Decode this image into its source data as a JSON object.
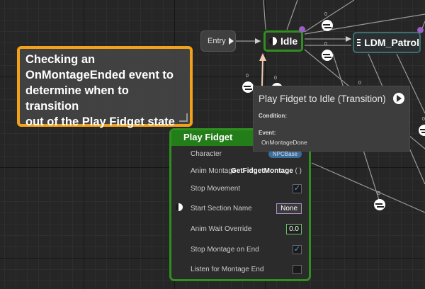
{
  "graph": {
    "entry_label": "Entry",
    "idle_label": "Idle",
    "patrol_label": "LDM_Patrol",
    "transition_counts": [
      "0",
      "0",
      "0",
      "0",
      "0",
      "0",
      "0"
    ]
  },
  "comment": {
    "text_lines": [
      "Checking an",
      "OnMontageEnded event to",
      "determine when to transition",
      "out of the Play Fidget state"
    ]
  },
  "node": {
    "title": "Play Fidget",
    "rows": [
      {
        "label": "Character",
        "value": "NPCBase"
      },
      {
        "label": "Anim Montage",
        "value": "GetFidgetMontage",
        "value_suffix": "( )"
      },
      {
        "label": "Stop Movement",
        "checked": true
      },
      {
        "label": "Start Section Name",
        "value": "None"
      },
      {
        "label": "Anim Wait Override",
        "value": "0.0"
      },
      {
        "label": "Stop Montage on End",
        "checked": true
      },
      {
        "label": "Listen for Montage End",
        "checked": false
      }
    ]
  },
  "tooltip": {
    "title": "Play Fidget to Idle (Transition)",
    "condition_label": "Condition:",
    "event_label": "Event:",
    "event_value": "OnMontageDone"
  },
  "colors": {
    "state_green": "#2f8f1f",
    "comment_orange": "#f2a21a",
    "patrol_teal": "#3e6e6e",
    "rule_purple": "#9a5ec6"
  }
}
